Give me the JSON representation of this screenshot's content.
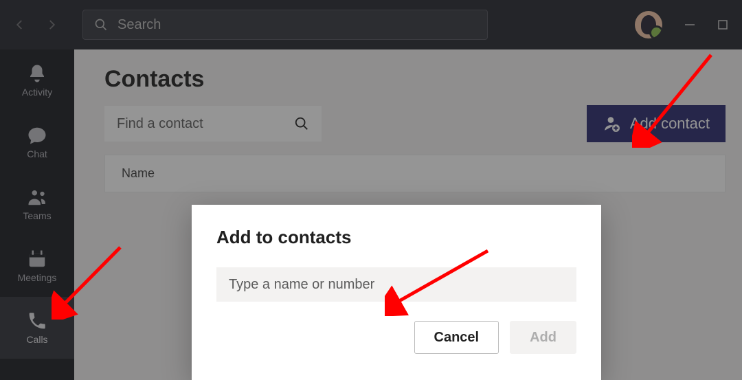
{
  "search": {
    "placeholder": "Search"
  },
  "rail": {
    "activity": "Activity",
    "chat": "Chat",
    "teams": "Teams",
    "meetings": "Meetings",
    "calls": "Calls"
  },
  "page": {
    "title": "Contacts",
    "find_placeholder": "Find a contact",
    "add_contact_label": "Add contact",
    "table_header_name": "Name"
  },
  "modal": {
    "title": "Add to contacts",
    "input_placeholder": "Type a name or number",
    "cancel_label": "Cancel",
    "add_label": "Add"
  }
}
